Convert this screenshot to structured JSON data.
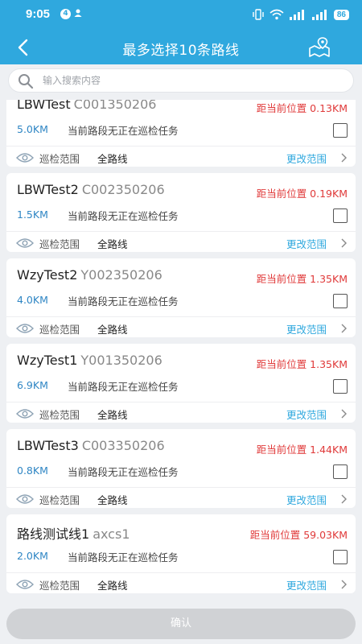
{
  "status_bar": {
    "time": "9:05",
    "notification_count": "4",
    "battery": "86"
  },
  "navbar": {
    "title": "最多选择10条路线"
  },
  "search": {
    "placeholder": "输入搜索内容",
    "value": ""
  },
  "routes": [
    {
      "name": "LBWTest",
      "code": "C001350206",
      "distance": "距当前位置 0.13KM",
      "length": "5.0KM",
      "status": "当前路段无正在巡检任务",
      "scope_label": "巡检范围",
      "scope_value": "全路线",
      "change_label": "更改范围",
      "checked": false
    },
    {
      "name": "LBWTest2",
      "code": "C002350206",
      "distance": "距当前位置 0.19KM",
      "length": "1.5KM",
      "status": "当前路段无正在巡检任务",
      "scope_label": "巡检范围",
      "scope_value": "全路线",
      "change_label": "更改范围",
      "checked": false
    },
    {
      "name": "WzyTest2",
      "code": "Y002350206",
      "distance": "距当前位置 1.35KM",
      "length": "4.0KM",
      "status": "当前路段无正在巡检任务",
      "scope_label": "巡检范围",
      "scope_value": "全路线",
      "change_label": "更改范围",
      "checked": false
    },
    {
      "name": "WzyTest1",
      "code": "Y001350206",
      "distance": "距当前位置 1.35KM",
      "length": "6.9KM",
      "status": "当前路段无正在巡检任务",
      "scope_label": "巡检范围",
      "scope_value": "全路线",
      "change_label": "更改范围",
      "checked": false
    },
    {
      "name": "LBWTest3",
      "code": "C003350206",
      "distance": "距当前位置 1.44KM",
      "length": "0.8KM",
      "status": "当前路段无正在巡检任务",
      "scope_label": "巡检范围",
      "scope_value": "全路线",
      "change_label": "更改范围",
      "checked": false
    },
    {
      "name": "路线测试线1",
      "code": "axcs1",
      "distance": "距当前位置 59.03KM",
      "length": "2.0KM",
      "status": "当前路段无正在巡检任务",
      "scope_label": "巡检范围",
      "scope_value": "全路线",
      "change_label": "更改范围",
      "checked": false
    }
  ],
  "footer": {
    "confirm_label": "确认"
  },
  "colors": {
    "header": "#2fa8de",
    "distance": "#e03a3a",
    "length": "#2f86c4",
    "link": "#2fa8de",
    "confirm_disabled": "#d0d2d5"
  },
  "icons": {
    "back": "back-arrow-icon",
    "map": "map-pin-icon",
    "search": "search-icon",
    "eye": "eye-icon",
    "chevron": "chevron-right-icon"
  }
}
